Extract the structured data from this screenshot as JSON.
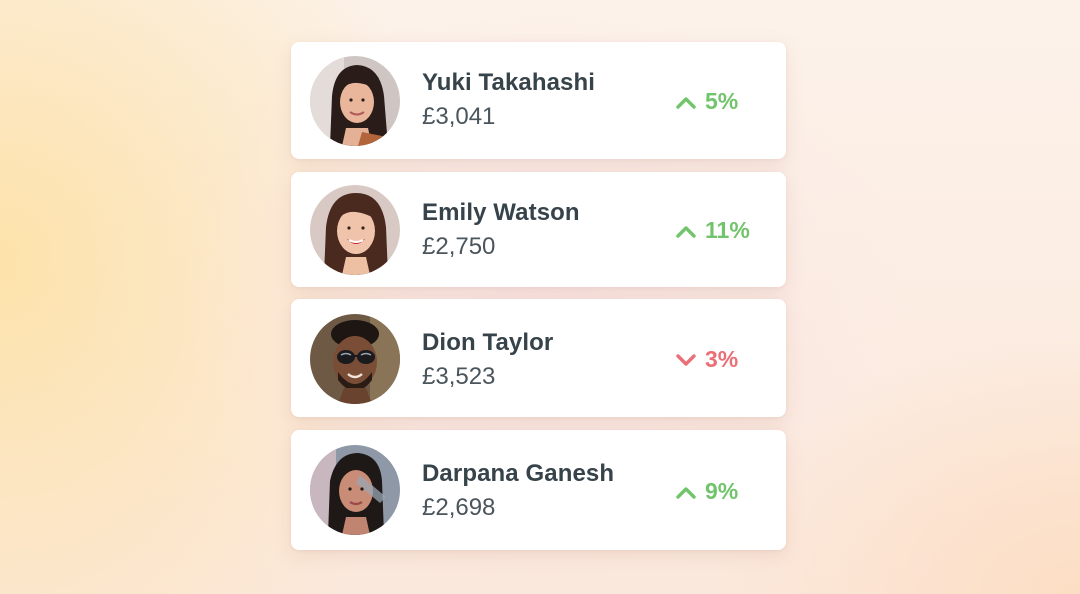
{
  "colors": {
    "up": "#72c46c",
    "down": "#ea6f76",
    "name_text": "#37434a",
    "amount_text": "#4a555c",
    "card_background": "#ffffff"
  },
  "people": [
    {
      "name": "Yuki Takahashi",
      "amount": "£3,041",
      "change": "5%",
      "trend": "up",
      "trend_icon": "chevron-up-icon"
    },
    {
      "name": "Emily Watson",
      "amount": "£2,750",
      "change": "11%",
      "trend": "up",
      "trend_icon": "chevron-up-icon"
    },
    {
      "name": "Dion Taylor",
      "amount": "£3,523",
      "change": "3%",
      "trend": "down",
      "trend_icon": "chevron-down-icon"
    },
    {
      "name": "Darpana Ganesh",
      "amount": "£2,698",
      "change": "9%",
      "trend": "up",
      "trend_icon": "chevron-up-icon"
    }
  ]
}
